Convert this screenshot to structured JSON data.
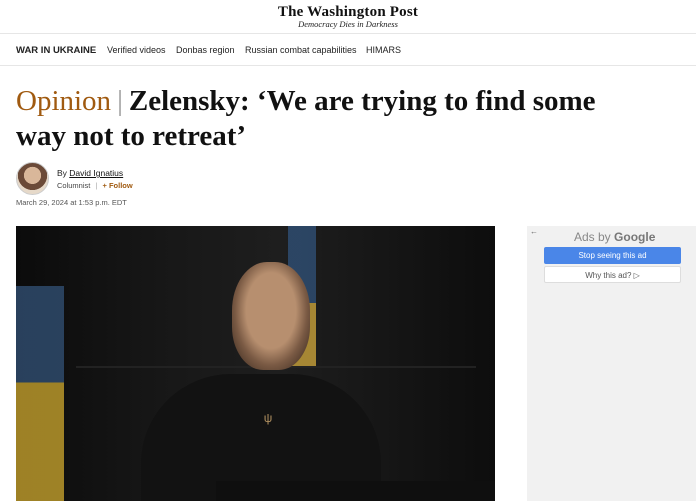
{
  "masthead": {
    "logo": "The Washington Post",
    "tagline": "Democracy Dies in Darkness"
  },
  "nav": {
    "items": [
      "WAR IN UKRAINE",
      "Verified videos",
      "Donbas region",
      "Russian combat capabilities",
      "HIMARS"
    ]
  },
  "article": {
    "section": "Opinion",
    "separator": "|",
    "title": "Zelensky: ‘We are trying to find some way not to retreat’",
    "byline_prefix": "By",
    "author": "David Ignatius",
    "role": "Columnist",
    "role_sep": "|",
    "follow_label": "+ Follow",
    "date": "March 29, 2024 at 1:53 p.m. EDT"
  },
  "ad": {
    "back_arrow": "←",
    "ads_by": "Ads by",
    "google": "Google",
    "stop_label": "Stop seeing this ad",
    "why_label": "Why this ad? ▷"
  },
  "colors": {
    "opinion": "#a05a10",
    "ad_button": "#4a86e8"
  }
}
